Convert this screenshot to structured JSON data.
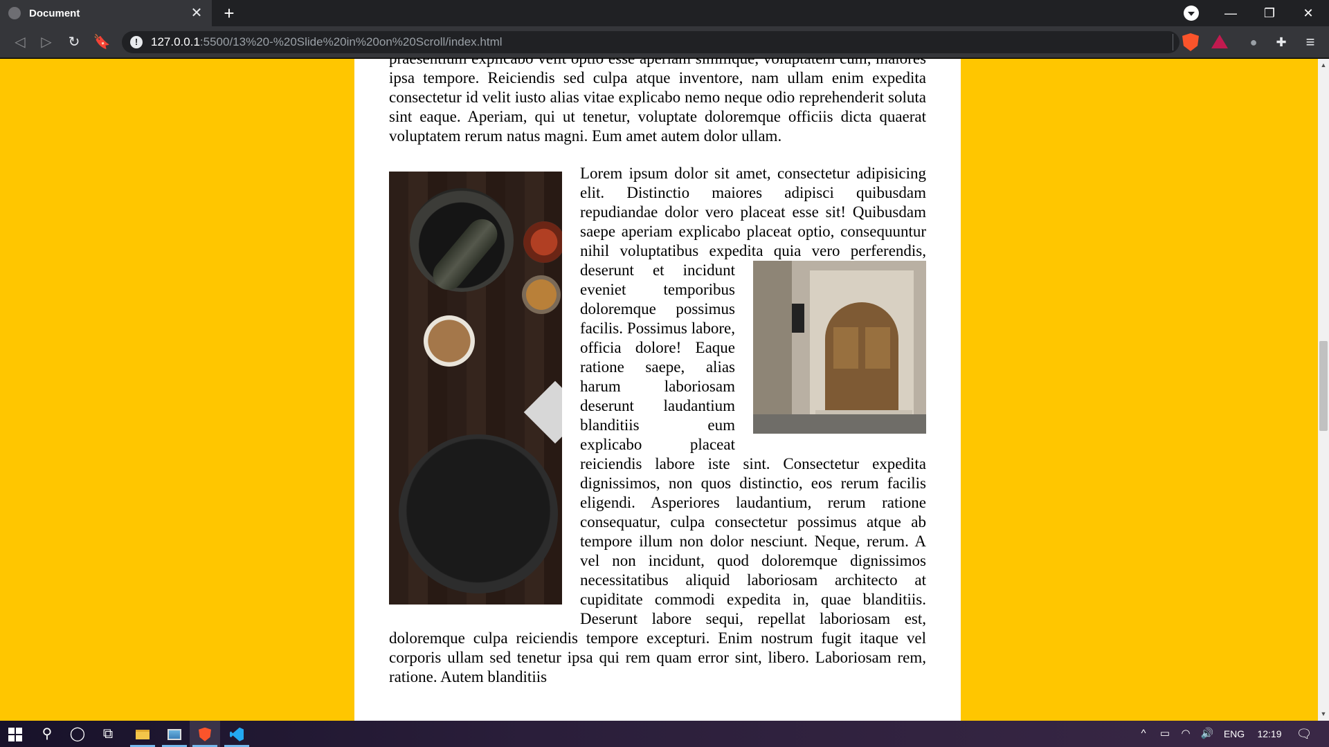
{
  "browser": {
    "tab_title": "Document",
    "tab_close": "✕",
    "new_tab": "+",
    "url_host": "127.0.0.1",
    "url_path": ":5500/13%20-%20Slide%20in%20on%20Scroll/index.html",
    "window_controls": {
      "minimize": "—",
      "maximize": "❐",
      "close": "✕"
    },
    "nav": {
      "back": "◁",
      "forward": "▷",
      "reload": "↻",
      "bookmark": "🔖"
    },
    "info_glyph": "!",
    "extensions": [
      "extension-icon",
      "puzzle-icon",
      "menu-icon"
    ]
  },
  "page": {
    "background_color": "#ffc600",
    "paragraph_top": "praesentium explicabo velit optio esse aperiam similique, voluptatem cum, maiores ipsa tempore. Reiciendis sed culpa atque inventore, nam ullam enim expedita consectetur id velit iusto alias vitae explicabo nemo neque odio reprehenderit soluta sint eaque. Aperiam, qui ut tenetur, voluptate doloremque officiis dicta quaerat voluptatem rerum natus magni. Eum amet autem dolor ullam.",
    "paragraph_main_before": "Lorem ipsum dolor sit amet, consectetur adipisicing elit. Distinctio maiores adipisci quibusdam repudiandae dolor vero placeat esse sit! Quibusdam saepe aperiam explicabo placeat optio, consequuntur nihil voluptatibus expedita quia vero perferendis, deserunt et incidunt",
    "paragraph_main_after": "eveniet temporibus doloremque possimus facilis. Possimus labore, officia dolore! Eaque ratione saepe, alias harum laboriosam deserunt laudantium blanditiis eum explicabo placeat reiciendis labore iste sint. Consectetur expedita dignissimos, non quos distinctio, eos rerum facilis eligendi. Asperiores laudantium, rerum ratione consequatur, culpa consectetur possimus atque ab tempore illum non dolor nesciunt. Neque, rerum. A vel non incidunt, quod doloremque dignissimos necessitatibus aliquid laboriosam architecto at cupiditate commodi expedita in, quae blanditiis. Deserunt labore sequi, repellat laboriosam est, doloremque culpa reiciendis tempore excepturi. Enim nostrum fugit itaque vel corporis ullam sed tenetur ipsa qui rem quam error sint, libero. Laboriosam rem, ratione. Autem blanditiis"
  },
  "scrollbar": {
    "up": "▲",
    "down": "▼"
  },
  "taskbar": {
    "search_glyph": "⚲",
    "cortana_glyph": "◯",
    "taskview_glyph": "⧉",
    "tray": {
      "chevron": "^",
      "battery": "▭",
      "wifi": "◠",
      "volume": "🔊",
      "language": "ENG",
      "time": "12:19",
      "notifications": "🗨"
    }
  }
}
